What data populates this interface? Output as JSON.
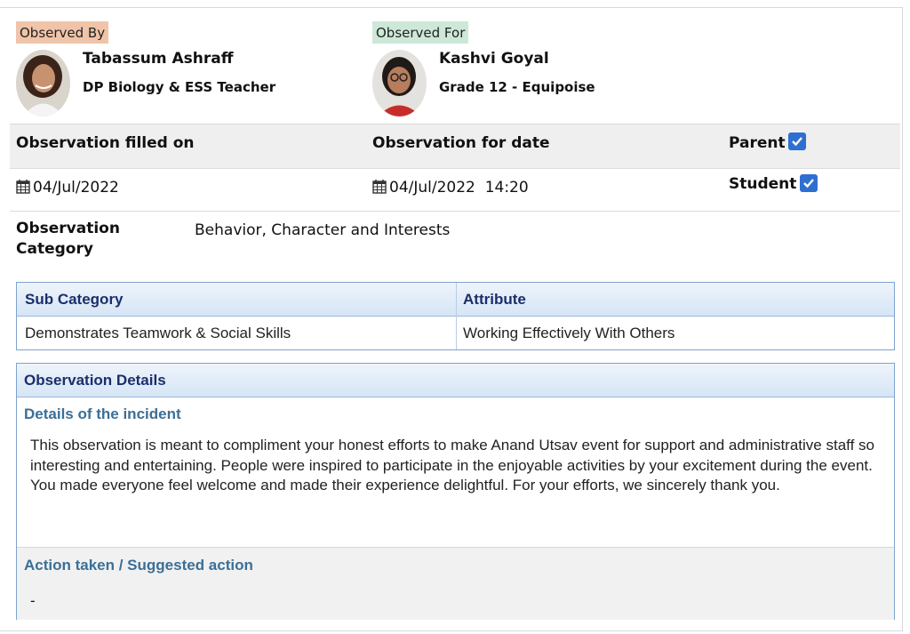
{
  "observed_by": {
    "tag": "Observed By",
    "name": "Tabassum Ashraff",
    "role": "DP Biology & ESS Teacher"
  },
  "observed_for": {
    "tag": "Observed For",
    "name": "Kashvi Goyal",
    "role": "Grade 12 - Equipoise"
  },
  "info": {
    "filled_on_label": "Observation filled on",
    "filled_on_value": "04/Jul/2022",
    "for_date_label": "Observation for date",
    "for_date_value": "04/Jul/2022",
    "for_time_value": "14:20",
    "parent_label": "Parent",
    "parent_checked": true,
    "student_label": "Student",
    "student_checked": true,
    "checkbox_color": "#2f6fd1"
  },
  "category": {
    "label": "Observation Category",
    "value": "Behavior, Character and Interests"
  },
  "subcategory_table": {
    "headers": [
      "Sub Category",
      "Attribute"
    ],
    "rows": [
      [
        "Demonstrates Teamwork & Social Skills",
        "Working Effectively With Others"
      ]
    ]
  },
  "details": {
    "heading": "Observation Details",
    "incident_title": "Details of the incident",
    "incident_text": "This observation is meant to compliment your honest efforts to make Anand Utsav event for support and administrative staff so interesting and entertaining. People were inspired to participate in the enjoyable activities by your excitement during the event. You made everyone feel welcome and made their experience delightful. For your efforts, we sincerely thank you.",
    "action_title": "Action taken / Suggested action",
    "action_value": "-"
  },
  "icons": {
    "calendar": "calendar-icon",
    "checkbox": "check-icon"
  }
}
